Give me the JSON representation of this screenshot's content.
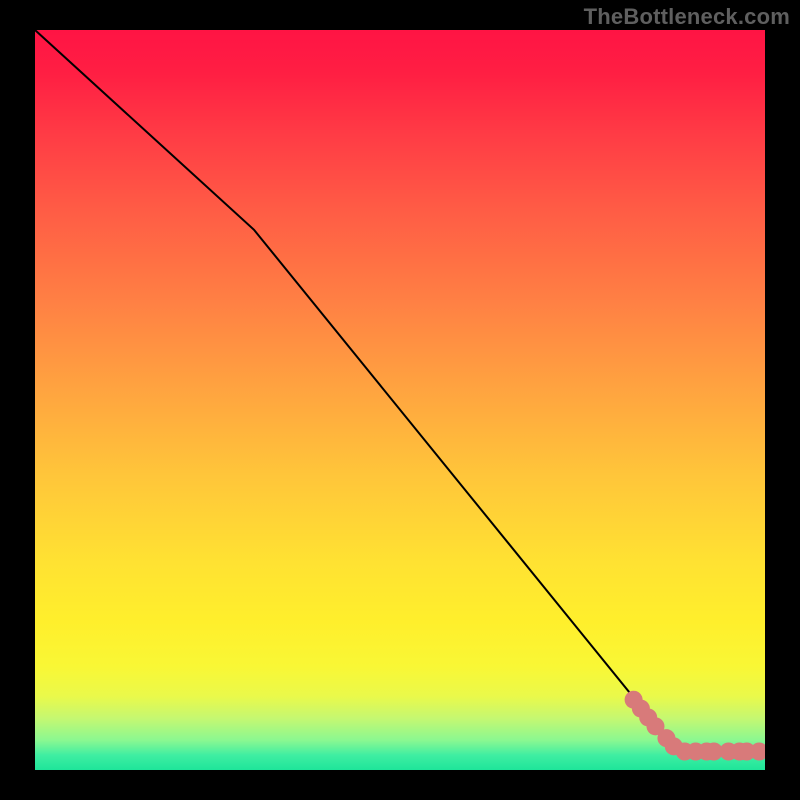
{
  "watermark": "TheBottleneck.com",
  "chart_data": {
    "type": "line",
    "title": "",
    "xlabel": "",
    "ylabel": "",
    "xlim": [
      0,
      100
    ],
    "ylim": [
      0,
      100
    ],
    "grid": false,
    "series": [
      {
        "name": "curve",
        "x": [
          0,
          30,
          88,
          100
        ],
        "y": [
          100,
          73,
          2.5,
          2.5
        ],
        "stroke": "#000000",
        "stroke_width": 2
      }
    ],
    "markers": [
      {
        "name": "cluster-on-slope-1",
        "x": 82.0,
        "y": 9.5,
        "r": 4.5,
        "color": "#d87a7a"
      },
      {
        "name": "cluster-on-slope-2",
        "x": 83.0,
        "y": 8.3,
        "r": 4.5,
        "color": "#d87a7a"
      },
      {
        "name": "cluster-on-slope-3",
        "x": 84.0,
        "y": 7.1,
        "r": 4.5,
        "color": "#d87a7a"
      },
      {
        "name": "cluster-on-slope-4",
        "x": 85.0,
        "y": 5.9,
        "r": 4.5,
        "color": "#d87a7a"
      },
      {
        "name": "cluster-on-slope-5",
        "x": 86.5,
        "y": 4.3,
        "r": 3.8,
        "color": "#d87a7a"
      },
      {
        "name": "cluster-on-slope-6",
        "x": 87.5,
        "y": 3.2,
        "r": 3.8,
        "color": "#d87a7a"
      },
      {
        "name": "flat-small-1",
        "x": 89.0,
        "y": 2.5,
        "r": 2.8,
        "color": "#d87a7a"
      },
      {
        "name": "flat-small-2",
        "x": 90.5,
        "y": 2.5,
        "r": 2.8,
        "color": "#d87a7a"
      },
      {
        "name": "flat-pair-a1",
        "x": 92.0,
        "y": 2.5,
        "r": 3.5,
        "color": "#d87a7a"
      },
      {
        "name": "flat-pair-a2",
        "x": 93.0,
        "y": 2.5,
        "r": 3.5,
        "color": "#d87a7a"
      },
      {
        "name": "flat-gap",
        "x": 95.0,
        "y": 2.5,
        "r": 2.6,
        "color": "#d87a7a"
      },
      {
        "name": "flat-pair-b1",
        "x": 96.5,
        "y": 2.5,
        "r": 3.5,
        "color": "#d87a7a"
      },
      {
        "name": "flat-pair-b2",
        "x": 97.5,
        "y": 2.5,
        "r": 3.5,
        "color": "#d87a7a"
      },
      {
        "name": "flat-end",
        "x": 99.2,
        "y": 2.5,
        "r": 3.0,
        "color": "#d87a7a"
      }
    ]
  }
}
